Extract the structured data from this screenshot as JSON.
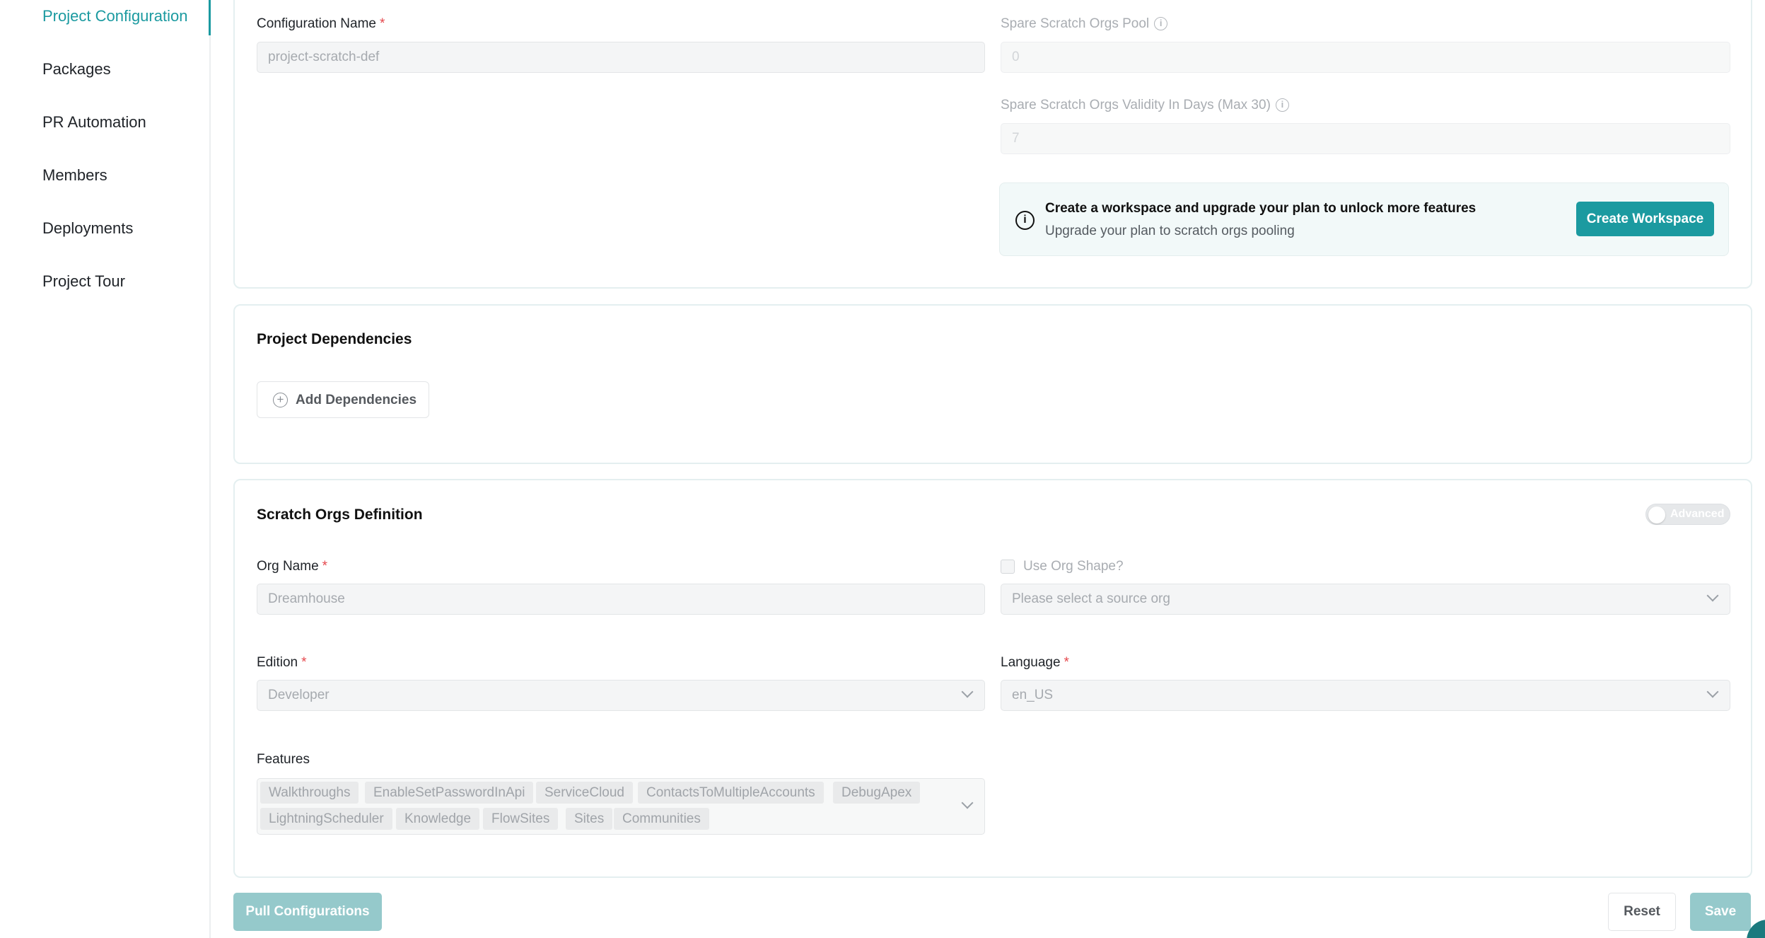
{
  "sidebar": {
    "items": [
      {
        "label": "Project Configuration",
        "active": true
      },
      {
        "label": "Packages"
      },
      {
        "label": "PR Automation"
      },
      {
        "label": "Members"
      },
      {
        "label": "Deployments"
      },
      {
        "label": "Project Tour"
      }
    ]
  },
  "config": {
    "name_label": "Configuration Name",
    "name_value": "project-scratch-def",
    "pool_label": "Spare Scratch Orgs Pool",
    "pool_value": "0",
    "validity_label": "Spare Scratch Orgs Validity In Days (Max 30)",
    "validity_value": "7",
    "banner_title": "Create a workspace and upgrade your plan to unlock more features",
    "banner_sub": "Upgrade your plan to scratch orgs pooling",
    "banner_button": "Create Workspace"
  },
  "dependencies": {
    "title": "Project Dependencies",
    "add_button": "Add Dependencies"
  },
  "scratch": {
    "title": "Scratch Orgs Definition",
    "toggle_label": "Advanced",
    "org_name_label": "Org Name",
    "org_name_value": "Dreamhouse",
    "org_shape_label": "Use Org Shape?",
    "source_org_placeholder": "Please select a source org",
    "edition_label": "Edition",
    "edition_value": "Developer",
    "language_label": "Language",
    "language_value": "en_US",
    "features_label": "Features",
    "features": [
      "Walkthroughs",
      "EnableSetPasswordInApi",
      "ServiceCloud",
      "ContactsToMultipleAccounts",
      "DebugApex",
      "LightningScheduler",
      "Knowledge",
      "FlowSites",
      "Sites",
      "Communities"
    ]
  },
  "footer": {
    "pull_button": "Pull Configurations",
    "reset_button": "Reset",
    "save_button": "Save"
  },
  "required_marker": "*",
  "info_glyph": "i",
  "plus_glyph": "+",
  "colors": {
    "accent": "#1b9aa0",
    "accent_disabled": "#95c9cb",
    "required": "#e5484d"
  }
}
